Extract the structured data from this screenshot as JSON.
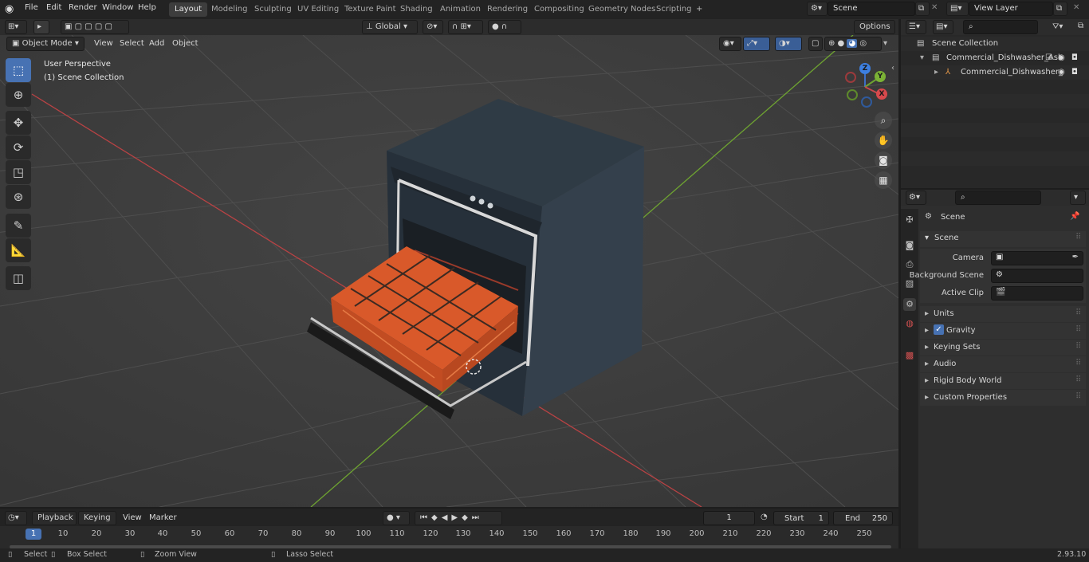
{
  "topbar": {
    "menus": [
      "File",
      "Edit",
      "Render",
      "Window",
      "Help"
    ],
    "workspaces": [
      "Layout",
      "Modeling",
      "Sculpting",
      "UV Editing",
      "Texture Paint",
      "Shading",
      "Animation",
      "Rendering",
      "Compositing",
      "Geometry Nodes",
      "Scripting"
    ],
    "add_tab": "+",
    "scene": "Scene",
    "view_layer": "View Layer"
  },
  "viewport": {
    "mode": "Object Mode",
    "menus": [
      "View",
      "Select",
      "Add",
      "Object"
    ],
    "transform_orientation": "Global",
    "options": "Options",
    "overlay_title": "User Perspective",
    "overlay_collection": "(1) Scene Collection",
    "gizmo_axes": [
      "Z",
      "Y",
      "X"
    ]
  },
  "outliner": {
    "items": [
      {
        "label": "Scene Collection"
      },
      {
        "label": "Commercial_Dishwasher_Asb"
      },
      {
        "label": "Commercial_Dishwasher_"
      }
    ]
  },
  "properties": {
    "breadcrumb": "Scene",
    "section": "Scene",
    "fields": [
      {
        "label": "Camera"
      },
      {
        "label": "Background Scene"
      },
      {
        "label": "Active Clip"
      }
    ],
    "panels": [
      "Units",
      "Gravity",
      "Keying Sets",
      "Audio",
      "Rigid Body World",
      "Custom Properties"
    ]
  },
  "timeline": {
    "menus": [
      "Playback",
      "Keying",
      "View",
      "Marker"
    ],
    "current_frame": "1",
    "start_label": "Start",
    "start_value": "1",
    "end_label": "End",
    "end_value": "250",
    "ticks": [
      "1",
      "10",
      "20",
      "30",
      "40",
      "50",
      "60",
      "70",
      "80",
      "90",
      "100",
      "110",
      "120",
      "130",
      "140",
      "150",
      "160",
      "170",
      "180",
      "190",
      "200",
      "210",
      "220",
      "230",
      "240",
      "250"
    ]
  },
  "statusbar": {
    "items": [
      "Select",
      "Box Select",
      "Zoom View",
      "Lasso Select"
    ],
    "version": "2.93.10"
  },
  "colors": {
    "accent": "#4772b3",
    "basket": "#e8662d",
    "x_axis": "#c8494b",
    "y_axis": "#7bb235"
  }
}
